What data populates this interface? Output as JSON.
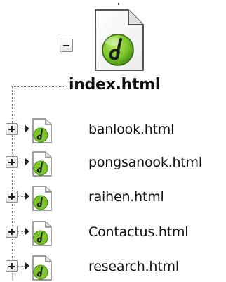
{
  "root": {
    "label": "index.html",
    "expander": "minus-box-icon",
    "icon": "dreamweaver-html-file-icon"
  },
  "children": [
    {
      "label": "banlook.html",
      "expander": "plus-box-icon",
      "icon": "dreamweaver-html-file-icon"
    },
    {
      "label": "pongsanook.html",
      "expander": "plus-box-icon",
      "icon": "dreamweaver-html-file-icon"
    },
    {
      "label": "raihen.html",
      "expander": "plus-box-icon",
      "icon": "dreamweaver-html-file-icon"
    },
    {
      "label": "Contactus.html",
      "expander": "plus-box-icon",
      "icon": "dreamweaver-html-file-icon"
    },
    {
      "label": "research.html",
      "expander": "plus-box-icon",
      "icon": "dreamweaver-html-file-icon"
    }
  ],
  "colors": {
    "icon_green": "#7cc427",
    "icon_green_dark": "#3d8a12",
    "connector": "#777777"
  }
}
